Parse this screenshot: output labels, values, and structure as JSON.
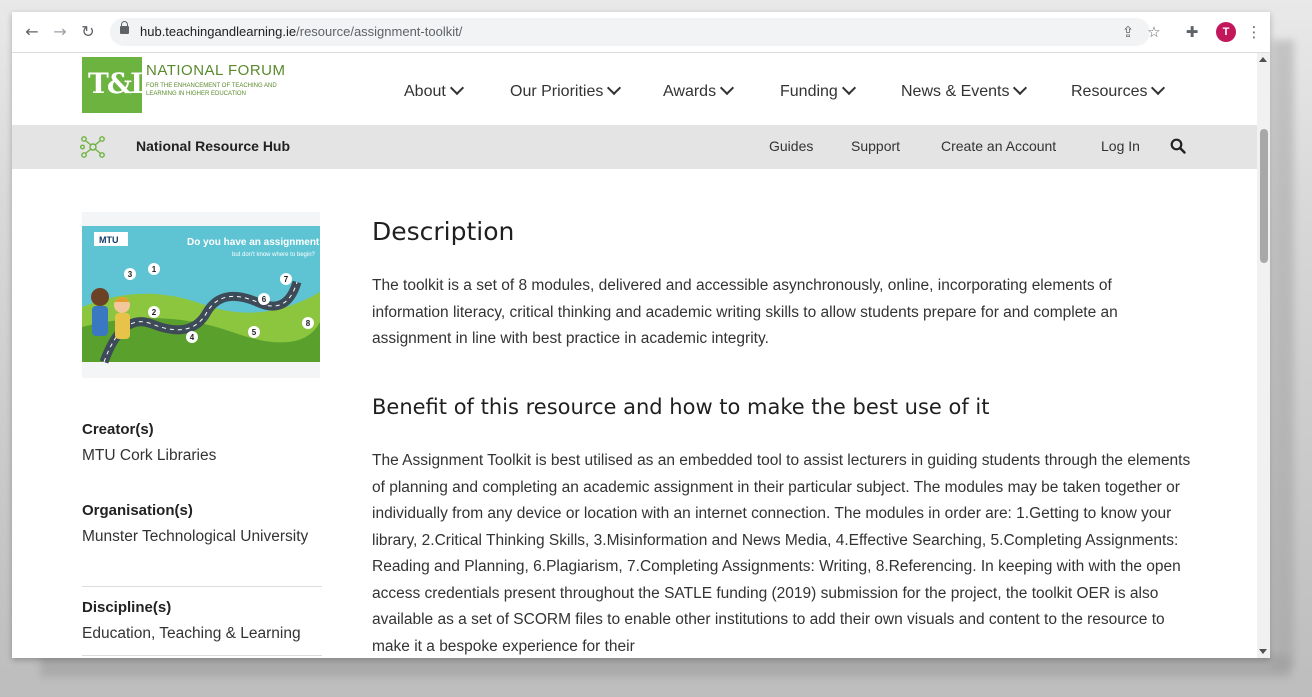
{
  "browser": {
    "url_domain": "hub.teachingandlearning.ie",
    "url_path": "/resource/assignment-toolkit/",
    "avatar_letter": "T",
    "avatar_color": "#c2185b"
  },
  "site": {
    "logo_mark": "T&L",
    "logo_title": "NATIONAL FORUM",
    "logo_subtitle": "FOR THE ENHANCEMENT OF TEACHING AND LEARNING IN HIGHER EDUCATION",
    "brand_color": "#6db33f",
    "nav": [
      "About",
      "Our Priorities",
      "Awards",
      "Funding",
      "News & Events",
      "Resources"
    ]
  },
  "subheader": {
    "hub_name": "National Resource Hub",
    "links": [
      "Guides",
      "Support",
      "Create an Account",
      "Log In"
    ]
  },
  "sidebar": {
    "thumbnail": {
      "badge": "MTU",
      "headline": "Do you have an assignment",
      "subline": "but don't know where to begin?",
      "steps": [
        "1",
        "2",
        "3",
        "4",
        "5",
        "6",
        "7",
        "8"
      ]
    },
    "creator_label": "Creator(s)",
    "creator_value": "MTU Cork Libraries",
    "organisation_label": "Organisation(s)",
    "organisation_value": "Munster Technological University",
    "discipline_label": "Discipline(s)",
    "discipline_value": "Education, Teaching & Learning"
  },
  "main": {
    "description_heading": "Description",
    "description_text": "The toolkit is a set of 8 modules, delivered and accessible asynchronously, online, incorporating elements of information literacy, critical thinking and academic writing skills to allow students prepare for and complete an assignment in line with best practice in academic integrity.",
    "benefit_heading": "Benefit of this resource and how to make the best use of it",
    "benefit_text": "The Assignment Toolkit is best utilised as an embedded tool to assist lecturers in guiding students through the elements of planning and completing an academic assignment in their particular subject. The modules may be taken together or individually from any device or location with an internet connection. The modules in order are: 1.Getting to know your library, 2.Critical Thinking Skills, 3.Misinformation and News Media, 4.Effective Searching, 5.Completing Assignments: Reading and Planning, 6.Plagiarism, 7.Completing Assignments: Writing, 8.Referencing. In keeping with with the open access credentials present throughout the SATLE funding (2019) submission for the project, the toolkit OER is also available as a set of SCORM files to enable other institutions to add their own visuals and content to the resource to make it a bespoke experience for their"
  }
}
